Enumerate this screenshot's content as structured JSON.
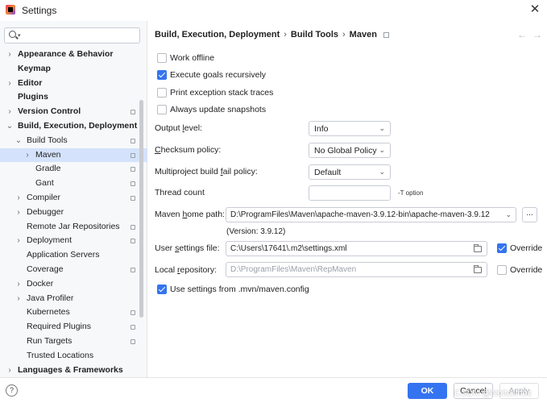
{
  "window": {
    "title": "Settings"
  },
  "sidebar": {
    "search_placeholder": "Q~",
    "items": [
      {
        "label": "Appearance & Behavior",
        "bold": true,
        "chevron": "›",
        "cfg": false
      },
      {
        "label": "Keymap",
        "bold": true,
        "chevron": "",
        "cfg": false
      },
      {
        "label": "Editor",
        "bold": true,
        "chevron": "›",
        "cfg": false
      },
      {
        "label": "Plugins",
        "bold": true,
        "chevron": "",
        "cfg": false
      },
      {
        "label": "Version Control",
        "bold": true,
        "chevron": "›",
        "cfg": true
      },
      {
        "label": "Build, Execution, Deployment",
        "bold": true,
        "chevron": "⌄",
        "cfg": false
      },
      {
        "label": "Build Tools",
        "bold": false,
        "chevron": "⌄",
        "cfg": true
      },
      {
        "label": "Maven",
        "bold": false,
        "chevron": "›",
        "cfg": true
      },
      {
        "label": "Gradle",
        "bold": false,
        "chevron": "",
        "cfg": true
      },
      {
        "label": "Gant",
        "bold": false,
        "chevron": "",
        "cfg": true
      },
      {
        "label": "Compiler",
        "bold": false,
        "chevron": "›",
        "cfg": true
      },
      {
        "label": "Debugger",
        "bold": false,
        "chevron": "›",
        "cfg": false
      },
      {
        "label": "Remote Jar Repositories",
        "bold": false,
        "chevron": "",
        "cfg": true
      },
      {
        "label": "Deployment",
        "bold": false,
        "chevron": "›",
        "cfg": true
      },
      {
        "label": "Application Servers",
        "bold": false,
        "chevron": "",
        "cfg": false
      },
      {
        "label": "Coverage",
        "bold": false,
        "chevron": "",
        "cfg": true
      },
      {
        "label": "Docker",
        "bold": false,
        "chevron": "›",
        "cfg": false
      },
      {
        "label": "Java Profiler",
        "bold": false,
        "chevron": "›",
        "cfg": false
      },
      {
        "label": "Kubernetes",
        "bold": false,
        "chevron": "",
        "cfg": true
      },
      {
        "label": "Required Plugins",
        "bold": false,
        "chevron": "",
        "cfg": true
      },
      {
        "label": "Run Targets",
        "bold": false,
        "chevron": "",
        "cfg": true
      },
      {
        "label": "Trusted Locations",
        "bold": false,
        "chevron": "",
        "cfg": false
      },
      {
        "label": "Languages & Frameworks",
        "bold": true,
        "chevron": "›",
        "cfg": false
      }
    ],
    "selected": "Maven"
  },
  "breadcrumb": {
    "parts": [
      "Build, Execution, Deployment",
      "Build Tools",
      "Maven"
    ],
    "separator": "›"
  },
  "options": {
    "work_offline": {
      "label": "Work offline",
      "checked": false
    },
    "execute_recursively": {
      "label": "Execute goals recursively",
      "checked": true
    },
    "print_traces": {
      "label": "Print exception stack traces",
      "checked": false
    },
    "update_snapshots": {
      "label": "Always update snapshots",
      "checked": false
    }
  },
  "fields": {
    "output_level": {
      "label_pre": "Output ",
      "label_u": "l",
      "label_post": "evel:",
      "value": "Info"
    },
    "checksum": {
      "label_pre": "",
      "label_u": "C",
      "label_post": "hecksum policy:",
      "value": "No Global Policy"
    },
    "multiproject": {
      "label_pre": "Multiproject build ",
      "label_u": "f",
      "label_post": "ail policy:",
      "value": "Default"
    },
    "thread_count": {
      "label": "Thread count",
      "value": "",
      "hint": "-T option"
    },
    "maven_home": {
      "label_pre": "Maven ",
      "label_u": "h",
      "label_post": "ome path:",
      "value": "D:\\ProgramFiles\\Maven\\apache-maven-3.9.12-bin\\apache-maven-3.9.12",
      "version": "(Version: 3.9.12)",
      "browse": "..."
    },
    "user_settings": {
      "label_pre": "User ",
      "label_u": "s",
      "label_post": "ettings file:",
      "value": "C:\\Users\\17641\\.m2\\settings.xml",
      "override_label": "Override",
      "override": true
    },
    "local_repo": {
      "label_pre": "Local ",
      "label_u": "r",
      "label_post": "epository:",
      "value": "D:\\ProgramFiles\\Maven\\RepMaven",
      "override_label": "Override",
      "override": false
    }
  },
  "use_mvn_config": {
    "label": "Use settings from .mvn/maven.config",
    "checked": true
  },
  "footer": {
    "help": "?",
    "ok": "OK",
    "cancel": "Cancel",
    "apply": "Apply"
  },
  "watermark": "CSDN @Noitcivhoc",
  "colors": {
    "accent": "#3574f0",
    "selection": "#d4e2fb",
    "sidebar_bg": "#f7f8fa"
  }
}
